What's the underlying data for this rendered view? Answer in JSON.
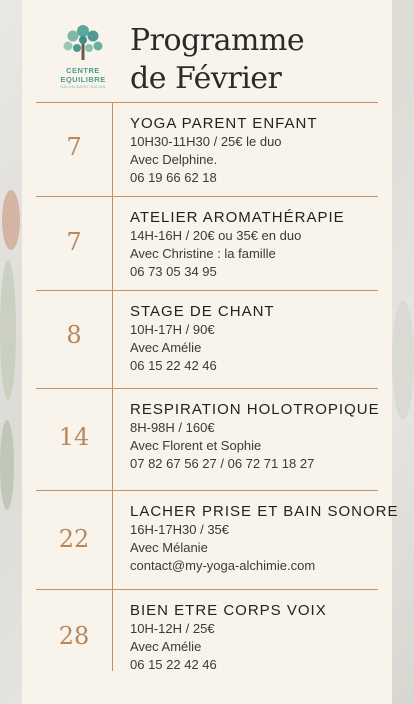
{
  "logo": {
    "line1": "CENTRE",
    "line2": "EQUILIBRE",
    "sub": "SALON-SAINT-SALVIN"
  },
  "title": {
    "line1": "Programme",
    "line2": "de Février"
  },
  "colors": {
    "accent": "#c98e63",
    "day": "#b8875c",
    "card": "#f8f4ec",
    "logo": "#4f9a90"
  },
  "events": [
    {
      "day": "7",
      "name": "YOGA PARENT ENFANT",
      "time": "10H30-11H30 / 25€ le duo",
      "host": "Avec Delphine.",
      "contact": "06 19 66 62 18"
    },
    {
      "day": "7",
      "name": "ATELIER AROMATHÉRAPIE",
      "time": "14H-16H / 20€ ou 35€ en duo",
      "host": "Avec Christine : la famille",
      "contact": "06 73 05 34 95"
    },
    {
      "day": "8",
      "name": "STAGE DE CHANT",
      "time": "10H-17H  / 90€",
      "host": "Avec Amélie",
      "contact": "06 15 22 42 46"
    },
    {
      "day": "14",
      "name": "RESPIRATION HOLOTROPIQUE",
      "time": "8H-98H / 160€",
      "host": "Avec Florent et Sophie",
      "contact": "07 82 67 56 27 / 06 72 71 18 27"
    },
    {
      "day": "22",
      "name": "LACHER PRISE ET BAIN SONORE",
      "time": "16H-17H30 / 35€",
      "host": "Avec Mélanie",
      "contact": "contact@my-yoga-alchimie.com"
    },
    {
      "day": "28",
      "name": "BIEN ETRE CORPS VOIX",
      "time": "10H-12H / 25€",
      "host": "Avec Amélie",
      "contact": "06 15 22 42 46"
    }
  ]
}
